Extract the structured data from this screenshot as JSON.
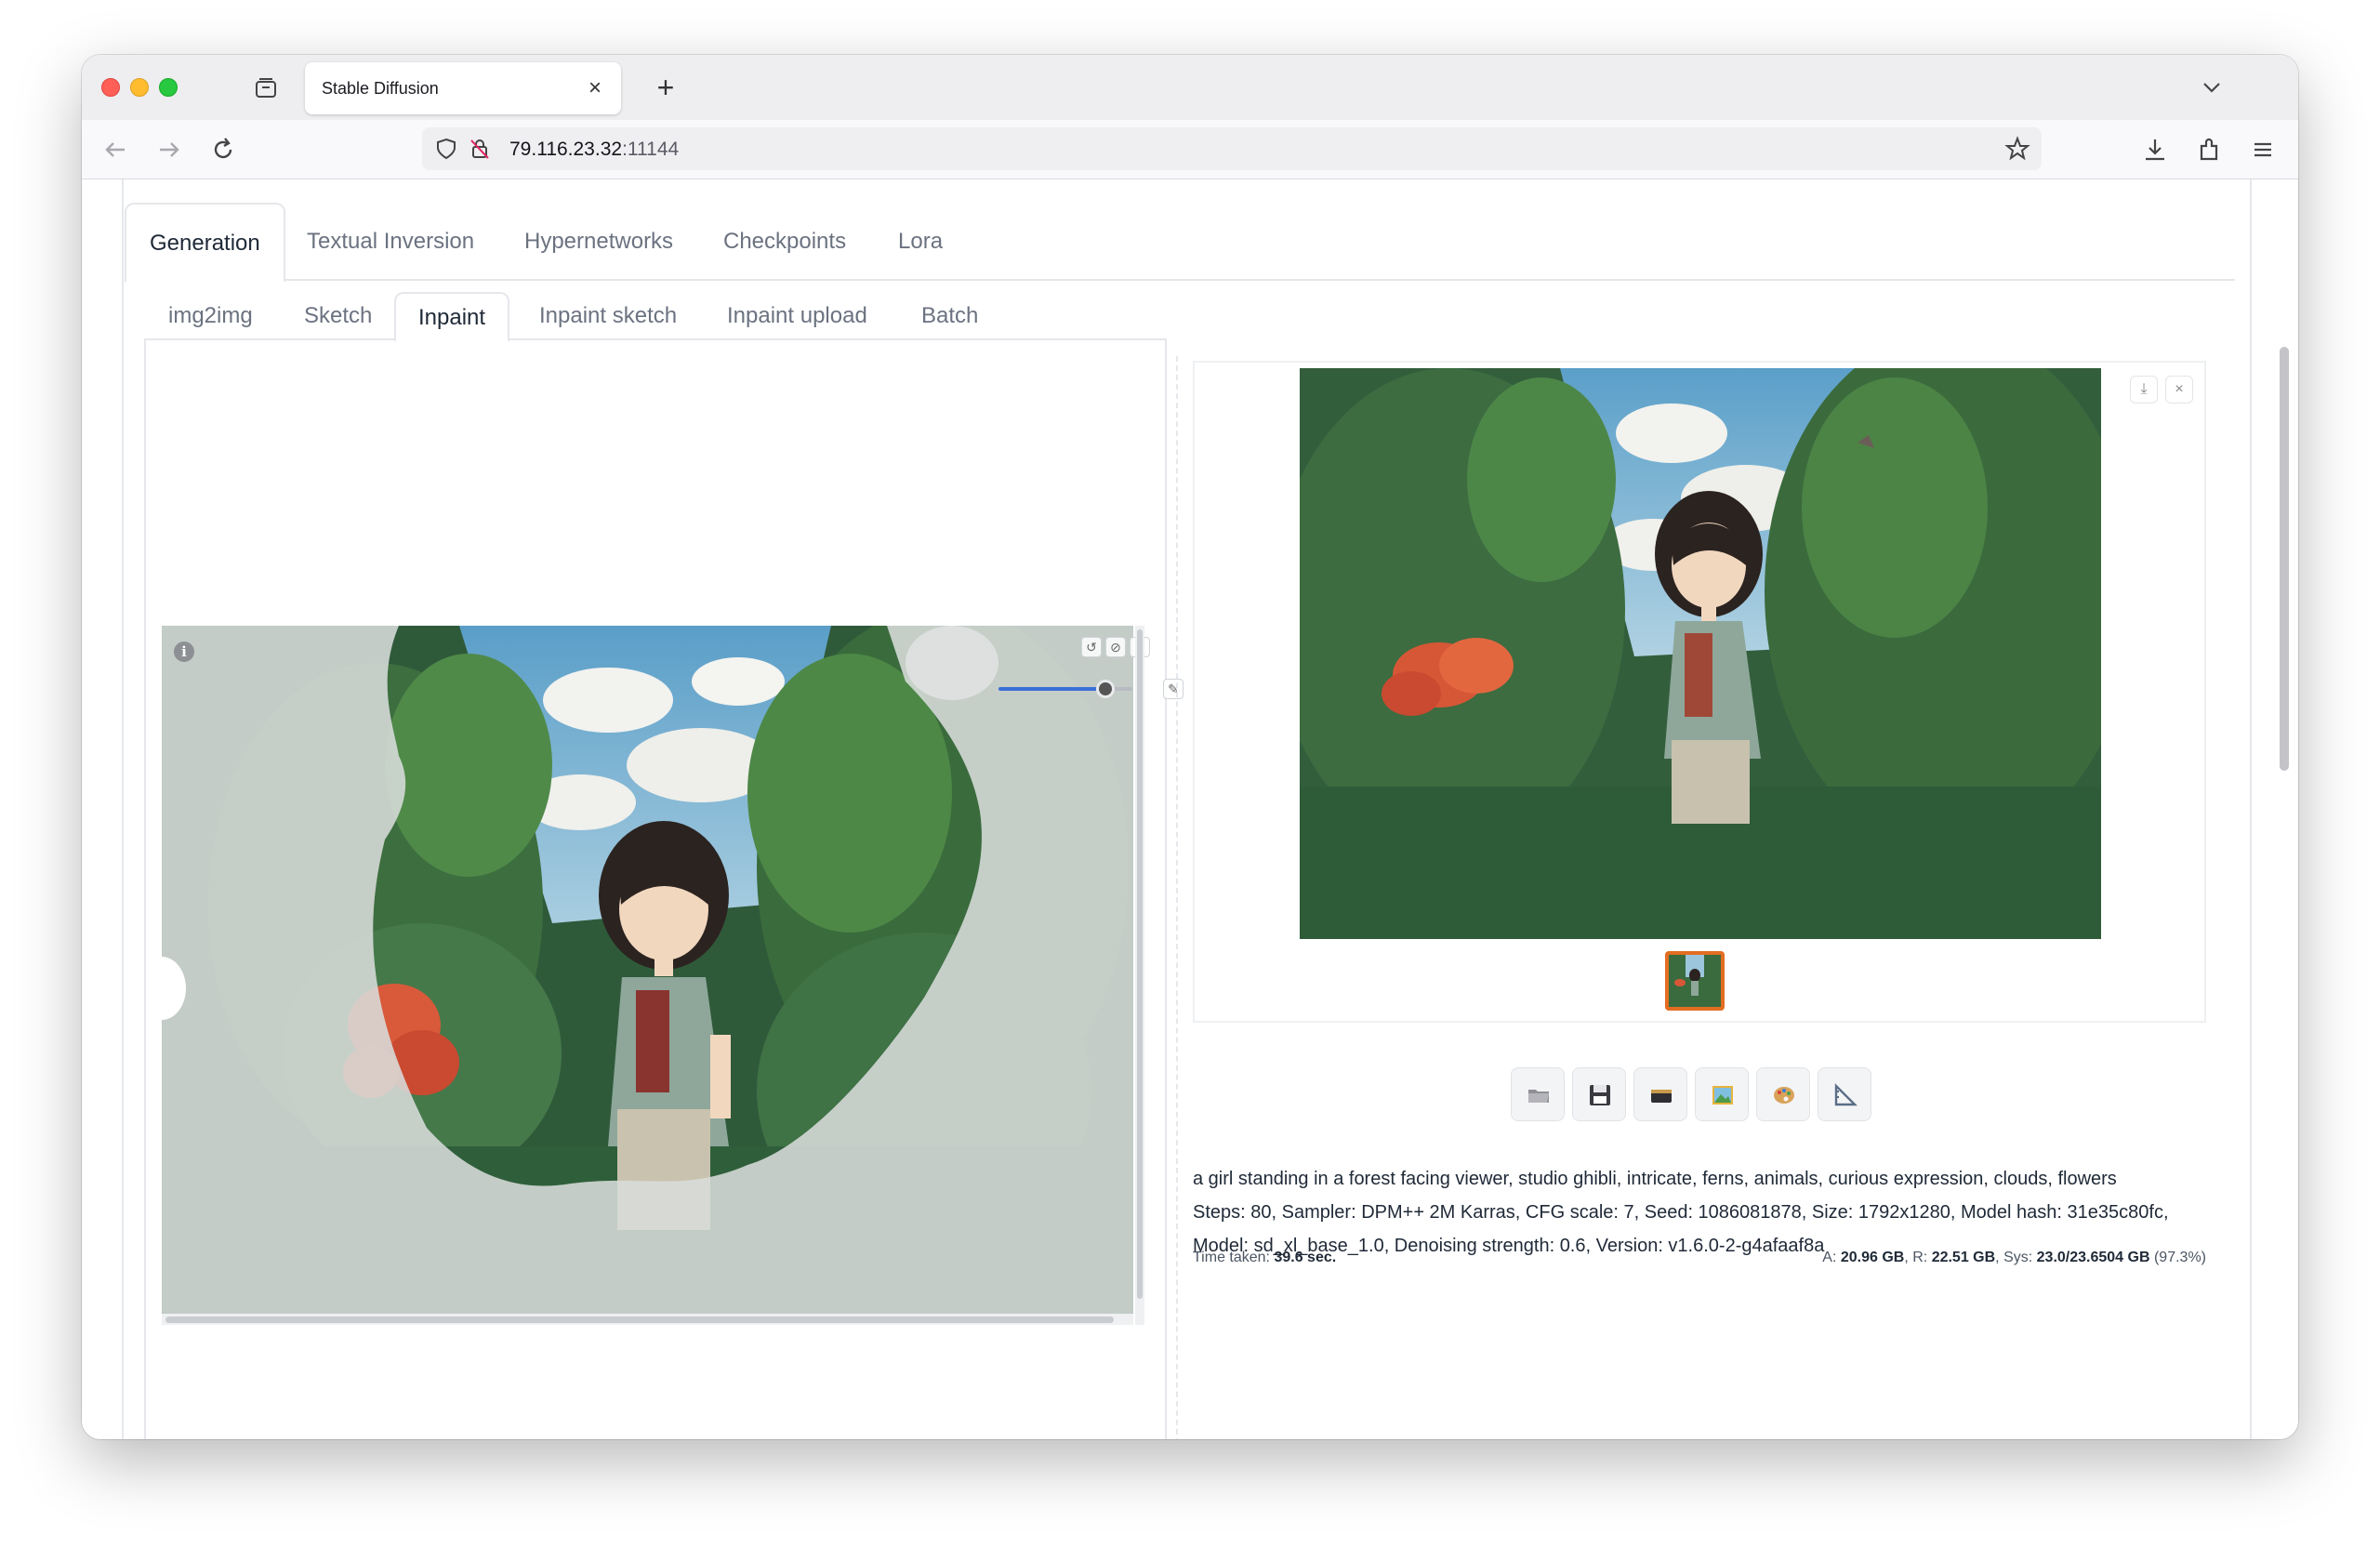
{
  "browser": {
    "tab_title": "Stable Diffusion",
    "url_host": "79.116.23.32",
    "url_port": ":11144"
  },
  "main_tabs": [
    "Generation",
    "Textual Inversion",
    "Hypernetworks",
    "Checkpoints",
    "Lora"
  ],
  "sub_tabs": [
    "img2img",
    "Sketch",
    "Inpaint",
    "Inpaint sketch",
    "Inpaint upload",
    "Batch"
  ],
  "active_main_tab": "Generation",
  "active_sub_tab": "Inpaint",
  "output": {
    "prompt": "a girl standing in a forest facing viewer, studio ghibli, intricate, ferns, animals, curious expression, clouds, flowers",
    "params_line1": "Steps: 80, Sampler: DPM++ 2M Karras, CFG scale: 7, Seed: 1086081878, Size: 1792x1280, Model hash: 31e35c80fc,",
    "params_line2": "Model: sd_xl_base_1.0, Denoising strength: 0.6, Version: v1.6.0-2-g4afaaf8a",
    "time_label": "Time taken:",
    "time_value": "39.6 sec.",
    "mem_a_label": "A:",
    "mem_a": "20.96 GB",
    "mem_r_label": "R:",
    "mem_r": "22.51 GB",
    "mem_sys_label": "Sys:",
    "mem_sys": "23.0/23.6504 GB",
    "mem_pct": "(97.3%)"
  },
  "action_buttons": [
    "folder-icon",
    "save-icon",
    "zip-icon",
    "image-icon",
    "palette-icon",
    "ruler-icon"
  ],
  "brush_size_fraction": 0.8,
  "colors": {
    "accent_blue": "#3b6fd8",
    "thumb_border": "#e36d21"
  }
}
